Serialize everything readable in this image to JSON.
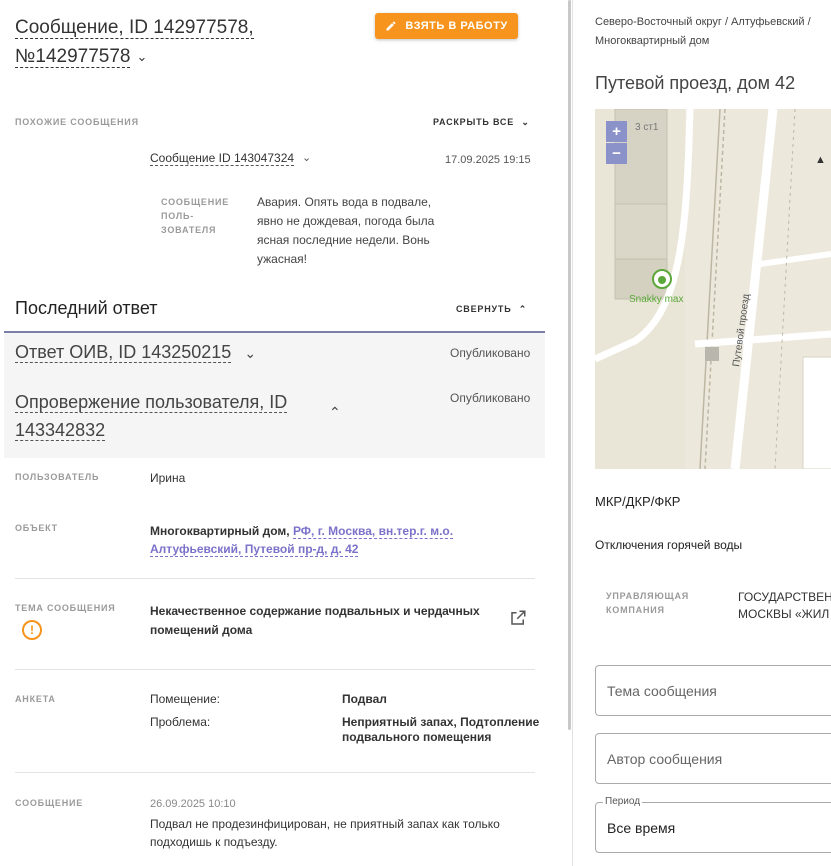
{
  "header": {
    "title_line1": "Сообщение, ID 142977578,",
    "title_line2": "№142977578",
    "take_button": "ВЗЯТЬ В РАБОТУ"
  },
  "similar": {
    "label": "ПОХОЖИЕ СООБЩЕНИЯ",
    "expand_all": "РАСКРЫТЬ ВСЕ",
    "item": {
      "link": "Сообщение ID 143047324",
      "date": "17.09.2025 19:15",
      "field_label_1": "СООБЩЕНИЕ",
      "field_label_2": "ПОЛЬ-",
      "field_label_3": "ЗОВАТЕЛЯ",
      "text": "Авария. Опять вода в подвале, явно не дождевая, погода была ясная последние недели. Вонь ужасная!"
    }
  },
  "last_answer": {
    "title": "Последний ответ",
    "collapse": "СВЕРНУТЬ",
    "response1": {
      "title": "Ответ ОИВ, ID 143250215",
      "status": "Опубликовано"
    },
    "response2": {
      "title": "Опровержение пользователя, ID 143342832",
      "status": "Опубликовано"
    }
  },
  "details": {
    "user_label": "ПОЛЬЗОВАТЕЛЬ",
    "user_value": "Ирина",
    "object_label": "ОБЪЕКТ",
    "object_type": "Многоквартирный дом,",
    "object_addr_1": "РФ, г. Москва, вн.тер.г. м.о.",
    "object_addr_2": "Алтуфьевский, Путевой пр-д, д. 42",
    "topic_label": "ТЕМА СООБЩЕНИЯ",
    "topic_value": "Некачественное содержание подвальных и чердачных помещений дома",
    "form_label": "АНКЕТА",
    "form_rows": [
      {
        "key": "Помещение:",
        "value": "Подвал"
      },
      {
        "key": "Проблема:",
        "value": "Неприятный запах, Подтопление подвального помещения"
      }
    ],
    "message_label": "СООБЩЕНИЕ",
    "message_date": "26.09.2025 10:10",
    "message_text": "Подвал не продезинфицирован, не приятный запах как только подходишь к подъезду."
  },
  "right": {
    "breadcrumb_1": "Северо-Восточный округ / Алтуфьевский /",
    "breadcrumb_2": "Многоквартирный дом",
    "address": "Путевой проезд, дом 42",
    "map": {
      "zoom_in": "+",
      "zoom_out": "−",
      "building_label": "3 ст1",
      "poi": "Snakky max",
      "street": "Путевой проезд"
    },
    "mkr": "МКР/ДКР/ФКР",
    "hot_water": "Отключения горячей воды",
    "uk_label_1": "УПРАВЛЯЮЩАЯ",
    "uk_label_2": "КОМПАНИЯ",
    "uk_value_1": "ГОСУДАРСТВЕН",
    "uk_value_2": "МОСКВЫ «ЖИЛ",
    "topic_field_placeholder": "Тема сообщения",
    "author_field_placeholder": "Автор сообщения",
    "period_label": "Период",
    "period_value": "Все время"
  },
  "colors": {
    "accent_orange": "#f7941d",
    "link_purple": "#7b72c9",
    "zoom_blue": "#8a92c9"
  }
}
